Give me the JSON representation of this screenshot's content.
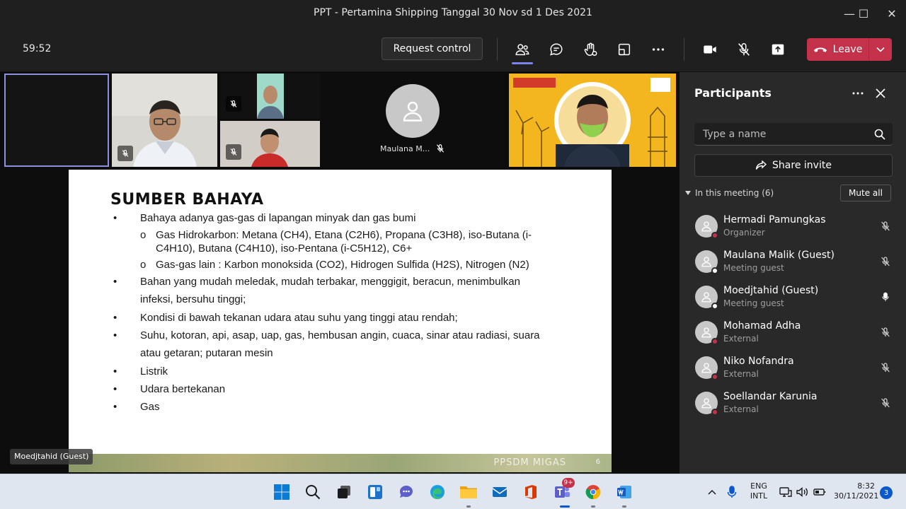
{
  "window": {
    "title": "PPT - Pertamina Shipping Tanggal 30 Nov sd 1 Des 2021",
    "minimize_glyph": "—",
    "maximize_glyph": "☐",
    "close_glyph": "✕"
  },
  "toolbar": {
    "timer": "59:52",
    "request_control": "Request control",
    "leave": "Leave",
    "icons": [
      "people-icon",
      "chat-icon",
      "raise-hand-icon",
      "rooms-icon",
      "more-icon",
      "camera-icon",
      "mic-off-icon",
      "share-icon"
    ],
    "leave_color": "#c4314b",
    "accent_color": "#7b83eb"
  },
  "gallery": {
    "tile5_name": "Maulana M..."
  },
  "slide": {
    "title": "SUMBER BAHAYA",
    "bullets": [
      {
        "mark": "•",
        "text": "Bahaya adanya gas-gas di lapangan minyak dan gas bumi"
      },
      {
        "mark": "o",
        "text": "Gas Hidrokarbon: Metana (CH4), Etana (C2H6), Propana (C3H8), iso-Butana (i-"
      },
      {
        "mark": "",
        "text": "C4H10), Butana (C4H10), iso-Pentana (i-C5H12), C6+"
      },
      {
        "mark": "o",
        "text": "Gas-gas lain : Karbon monoksida (CO2), Hidrogen Sulfida (H2S), Nitrogen (N2)"
      },
      {
        "mark": "•",
        "text": "Bahan yang mudah meledak, mudah terbakar, menggigit, beracun, menimbulkan"
      },
      {
        "mark": "",
        "text": "infeksi, bersuhu tinggi;"
      },
      {
        "mark": "•",
        "text": "Kondisi di bawah tekanan udara atau suhu yang tinggi atau rendah;"
      },
      {
        "mark": "•",
        "text": "Suhu, kotoran, api, asap, uap, gas, hembusan angin, cuaca, sinar atau radiasi, suara"
      },
      {
        "mark": "",
        "text": "atau getaran; putaran mesin"
      },
      {
        "mark": "•",
        "text": "Listrik"
      },
      {
        "mark": "•",
        "text": "Udara bertekanan"
      },
      {
        "mark": "•",
        "text": "Gas"
      }
    ],
    "footer_brand": "PPSDM MIGAS",
    "page_number": "6",
    "presenter": "Moedjtahid (Guest)"
  },
  "panel": {
    "title": "Participants",
    "search_placeholder": "Type a name",
    "share_invite": "Share invite",
    "section_label": "In this meeting (6)",
    "mute_all": "Mute all",
    "participants": [
      {
        "name": "Hermadi Pamungkas",
        "role": "Organizer",
        "status_color": "#c4314b",
        "mic": "muted"
      },
      {
        "name": "Maulana Malik (Guest)",
        "role": "Meeting guest",
        "status_color": "#ffffff",
        "mic": "muted"
      },
      {
        "name": "Moedjtahid (Guest)",
        "role": "Meeting guest",
        "status_color": "#ffffff",
        "mic": "on"
      },
      {
        "name": "Mohamad Adha",
        "role": "External",
        "status_color": "#c4314b",
        "mic": "muted"
      },
      {
        "name": "Niko Nofandra",
        "role": "External",
        "status_color": "#c4314b",
        "mic": "muted"
      },
      {
        "name": "Soellandar Karunia",
        "role": "External",
        "status_color": "#c4314b",
        "mic": "muted"
      }
    ]
  },
  "taskbar": {
    "apps": [
      "windows-start-icon",
      "search-icon",
      "task-view-icon",
      "widgets-icon",
      "chat-icon",
      "edge-icon",
      "file-explorer-icon",
      "mail-icon",
      "office-icon",
      "teams-icon",
      "chrome-icon",
      "word-icon"
    ],
    "teams_badge": "9+",
    "language_line1": "ENG",
    "language_line2": "INTL",
    "time": "8:32",
    "date": "30/11/2021",
    "notifications": "3"
  }
}
